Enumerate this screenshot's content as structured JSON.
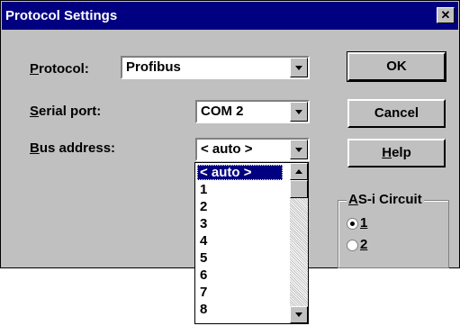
{
  "window": {
    "title": "Protocol Settings",
    "close_glyph": "✕"
  },
  "form": {
    "protocol": {
      "label_accel": "P",
      "label_rest": "rotocol:",
      "value": "Profibus"
    },
    "serial_port": {
      "label_accel": "S",
      "label_rest": "erial port:",
      "value": "COM 2"
    },
    "bus_address": {
      "label_accel": "B",
      "label_rest": "us address:",
      "value": "< auto >"
    }
  },
  "buttons": {
    "ok": "OK",
    "cancel": "Cancel",
    "help_accel": "H",
    "help_rest": "elp"
  },
  "as_i_circuit": {
    "title_accel": "A",
    "title_rest": "S-i Circuit",
    "options": [
      {
        "label": "1",
        "checked": true
      },
      {
        "label": "2",
        "checked": false
      }
    ]
  },
  "bus_address_dropdown": {
    "items": [
      "< auto >",
      "1",
      "2",
      "3",
      "4",
      "5",
      "6",
      "7",
      "8"
    ],
    "selected_index": 0
  },
  "colors": {
    "titlebar": "#000080",
    "face": "#c0c0c0",
    "selection": "#000080"
  }
}
